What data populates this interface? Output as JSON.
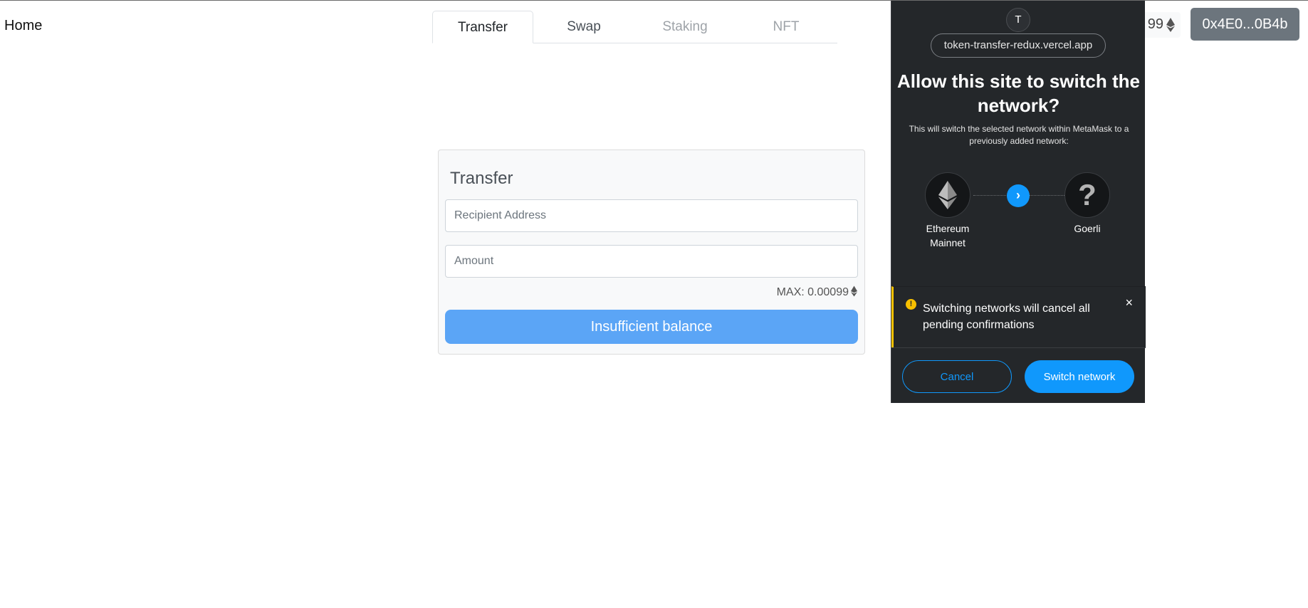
{
  "nav": {
    "home": "Home",
    "tabs": [
      {
        "label": "Transfer",
        "state": "active"
      },
      {
        "label": "Swap",
        "state": "normal"
      },
      {
        "label": "Staking",
        "state": "disabled"
      },
      {
        "label": "NFT",
        "state": "disabled"
      }
    ],
    "balance_fragment": "99",
    "address": "0x4E0...0B4b"
  },
  "transfer": {
    "title": "Transfer",
    "recipient_placeholder": "Recipient Address",
    "amount_placeholder": "Amount",
    "max_label": "MAX: 0.00099",
    "submit_label": "Insufficient balance"
  },
  "metamask": {
    "avatar_letter": "T",
    "origin": "token-transfer-redux.vercel.app",
    "title": "Allow this site to switch the network?",
    "description": "This will switch the selected network within MetaMask to a previously added network:",
    "from_network": "Ethereum Mainnet",
    "to_network": "Goerli",
    "to_network_icon": "?",
    "warning": "Switching networks will cancel all pending confirmations",
    "cancel_label": "Cancel",
    "switch_label": "Switch network",
    "colors": {
      "accent": "#1098fc",
      "warning": "#f8c000",
      "background": "#24272a"
    }
  }
}
